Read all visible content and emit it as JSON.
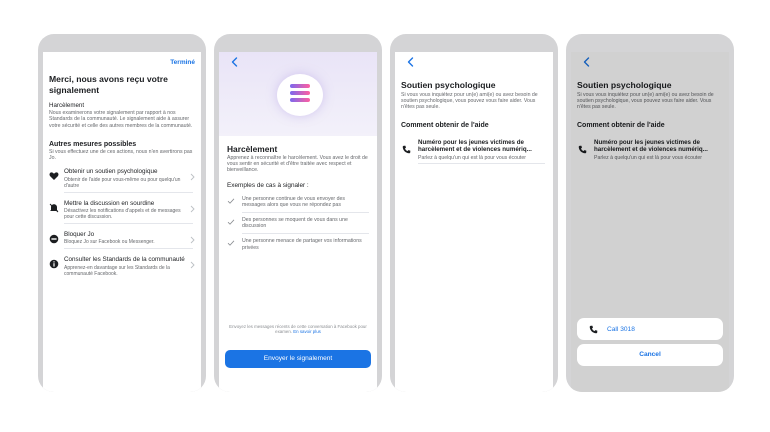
{
  "screen1": {
    "done_label": "Terminé",
    "title": "Merci, nous avons reçu votre signalement",
    "section": "Harcèlement",
    "section_text": "Nous examinerons votre signalement par rapport à nos Standards de la communauté. Le signalement aide à assurer votre sécurité et celle des autres membres de la communauté.",
    "more_title": "Autres mesures possibles",
    "more_text": "Si vous effectuez une de ces actions, nous n'en avertirons pas Jo.",
    "actions": [
      {
        "title": "Obtenir un soutien psychologique",
        "desc": "Obtenir de l'aide pour vous-même ou pour quelqu'un d'autre",
        "icon": "heart-icon"
      },
      {
        "title": "Mettre la discussion en sourdine",
        "desc": "Désactivez les notifications d'appels et de messages pour cette discussion.",
        "icon": "mute-icon"
      },
      {
        "title": "Bloquer Jo",
        "desc": "Bloquez Jo sur Facebook ou Messenger.",
        "icon": "block-icon"
      },
      {
        "title": "Consulter les Standards de la communauté",
        "desc": "Apprenez-en davantage sur les Standards de la communauté Facebook.",
        "icon": "info-icon"
      }
    ]
  },
  "screen2": {
    "title": "Harcèlement",
    "text": "Apprenez à reconnaître le harcèlement. Vous avez le droit de vous sentir en sécurité et d'être traitée avec respect et bienveillance.",
    "examples_title": "Exemples de cas à signaler :",
    "examples": [
      "Une personne continue de vous envoyer des messages alors que vous ne répondez pas",
      "Des personnes se moquent de vous dans une discussion",
      "Une personne menace de partager vos informations privées"
    ],
    "footer_note": "Envoyez les messages récents de cette conversation à Facebook pour examen.",
    "footer_link": "En savoir plus",
    "send_label": "Envoyer le signalement"
  },
  "screen3": {
    "title": "Soutien psychologique",
    "text": "Si vous vous inquiétez pour un(e) ami(e) ou avez besoin de soutien psychologique, vous pouvez vous faire aider. Vous n'êtes pas seule.",
    "help_title": "Comment obtenir de l'aide",
    "helpline_title": "Numéro pour les jeunes victimes de harcèlement et de violences numériq...",
    "helpline_desc": "Parlez à quelqu'un qui est là pour vous écouter"
  },
  "screen4": {
    "title": "Soutien psychologique",
    "text": "Si vous vous inquiétez pour un(e) ami(e) ou avez besoin de soutien psychologique, vous pouvez vous faire aider. Vous n'êtes pas seule.",
    "help_title": "Comment obtenir de l'aide",
    "helpline_title": "Numéro pour les jeunes victimes de harcèlement et de violences numériq...",
    "helpline_desc": "Parlez à quelqu'un qui est là pour vous écouter",
    "call_label": "Call 3018",
    "cancel_label": "Cancel"
  },
  "colors": {
    "accent": "#1b74e4",
    "frame": "#d4d4d6"
  }
}
